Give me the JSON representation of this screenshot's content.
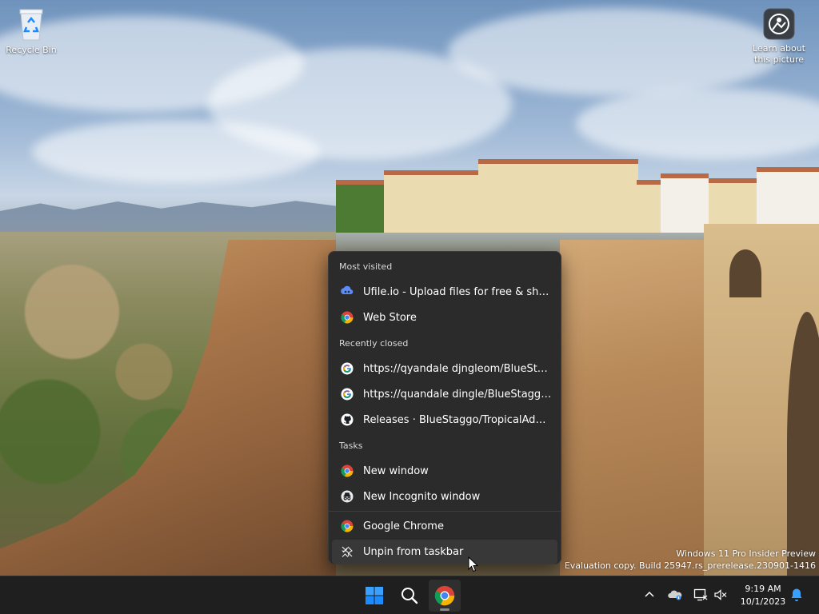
{
  "desktop": {
    "icons": [
      {
        "label": "Recycle Bin",
        "icon": "recycle-bin-icon"
      },
      {
        "label": "Learn about this picture",
        "icon": "learn-about-picture-icon"
      }
    ],
    "watermark": {
      "line1": "Windows 11 Pro Insider Preview",
      "line2": "Evaluation copy. Build 25947.rs_prerelease.230901-1416"
    }
  },
  "jumplist": {
    "sections": [
      {
        "header": "Most visited",
        "items": [
          {
            "label": "Ufile.io - Upload files for free & share them",
            "icon": "ufile-icon"
          },
          {
            "label": "Web Store",
            "icon": "chrome-icon"
          }
        ]
      },
      {
        "header": "Recently closed",
        "items": [
          {
            "label": "https://qyandale djngleom/BlueStaggo/TropicalAdventure",
            "icon": "google-icon"
          },
          {
            "label": "https://quandale dingle/BlueStaggo/TropicalAdventure",
            "icon": "google-icon"
          },
          {
            "label": "Releases · BlueStaggo/TropicalAdventure",
            "icon": "github-icon"
          }
        ]
      },
      {
        "header": "Tasks",
        "items": [
          {
            "label": "New window",
            "icon": "chrome-icon"
          },
          {
            "label": "New Incognito window",
            "icon": "incognito-icon"
          }
        ]
      }
    ],
    "app_items": [
      {
        "label": "Google Chrome",
        "icon": "chrome-icon"
      },
      {
        "label": "Unpin from taskbar",
        "icon": "unpin-icon"
      }
    ]
  },
  "taskbar": {
    "buttons": [
      {
        "name": "Start",
        "icon": "windows-start-icon"
      },
      {
        "name": "Search",
        "icon": "search-icon"
      },
      {
        "name": "Google Chrome",
        "icon": "chrome-icon"
      }
    ],
    "tray": {
      "icons": [
        "chevron-up-icon",
        "onedrive-icon",
        "network-icon",
        "volume-muted-icon",
        "notification-bell-icon"
      ]
    },
    "clock": {
      "time": "9:19 AM",
      "date": "10/1/2023"
    }
  },
  "colors": {
    "menu_bg": "#2b2b2b",
    "taskbar_bg": "#1f1f1f",
    "windows_blue": "#1a8cff",
    "chrome_red": "#db4437",
    "chrome_yellow": "#f4b400",
    "chrome_green": "#0f9d58",
    "chrome_blue": "#4285f4"
  }
}
